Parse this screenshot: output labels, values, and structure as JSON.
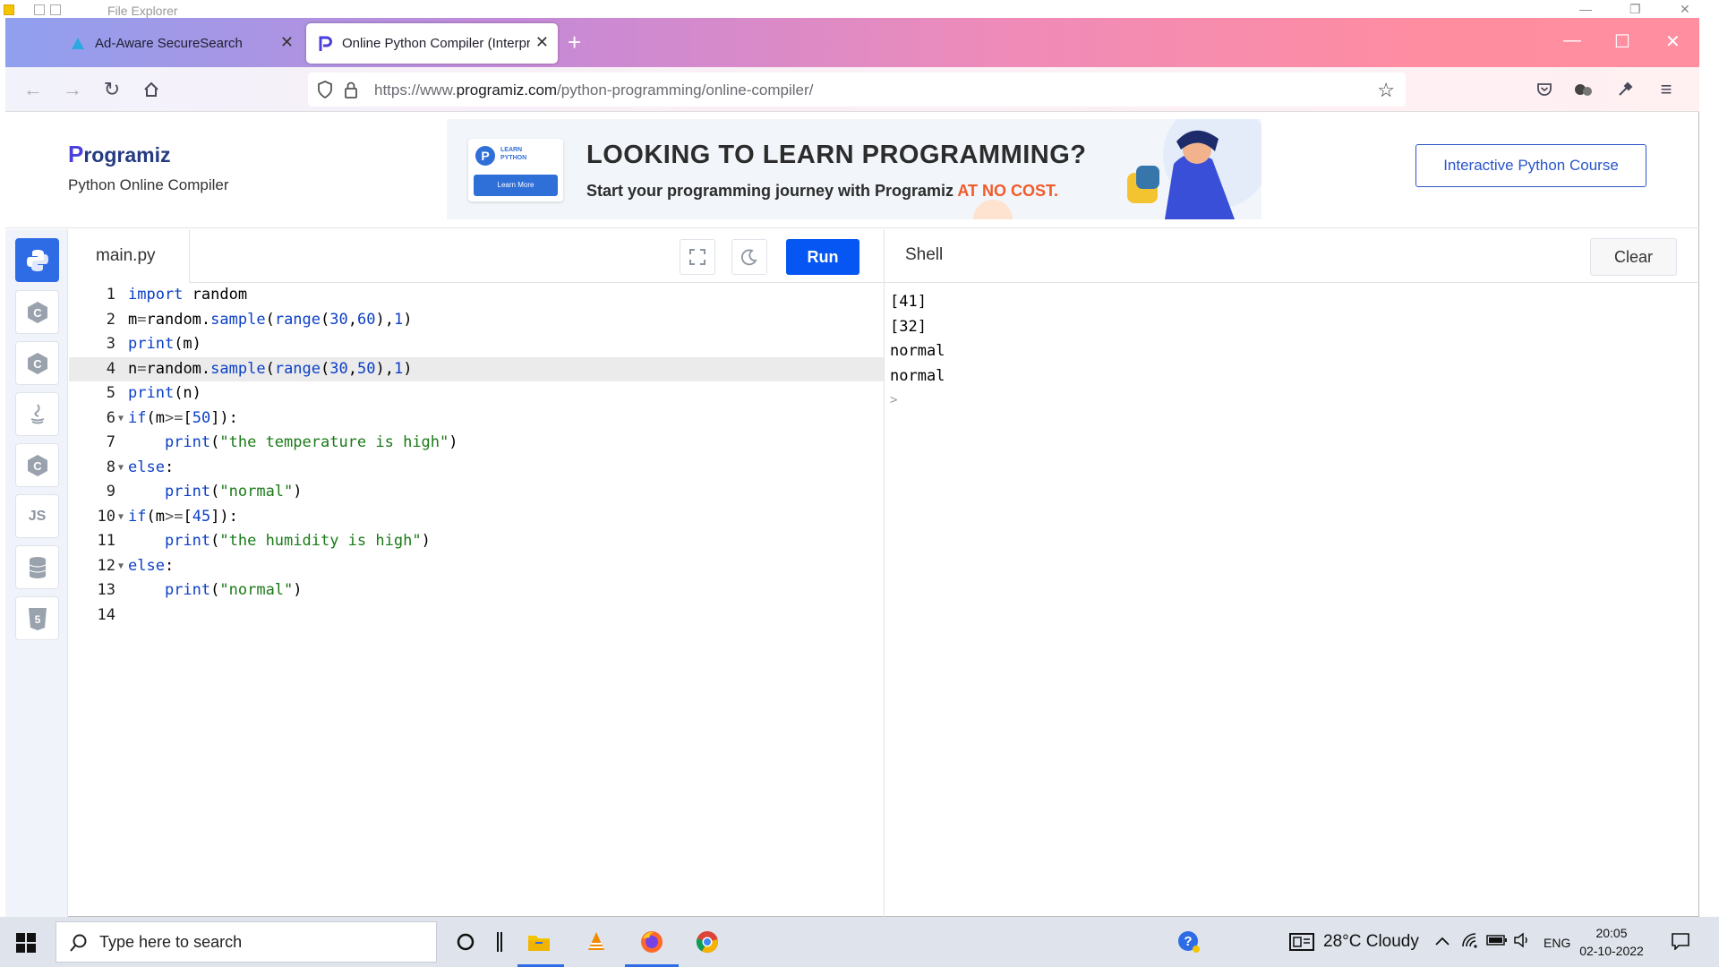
{
  "explorer": {
    "title": "File Explorer"
  },
  "browser": {
    "tabs": [
      {
        "label": "Ad-Aware SecureSearch",
        "active": false
      },
      {
        "label": "Online Python Compiler (Interpreter)",
        "active": true
      }
    ],
    "url_prefix": "https://www.",
    "url_domain": "programiz.com",
    "url_path": "/python-programming/online-compiler/"
  },
  "header": {
    "logo": "rogramiz",
    "logo_p": "P",
    "subtitle": "Python Online Compiler",
    "banner_title": "LOOKING TO LEARN PROGRAMMING?",
    "banner_sub": "Start your programming journey with Programiz ",
    "banner_highlight": "AT NO COST.",
    "banner_card_label": "LEARN PYTHON",
    "banner_card_btn": "Learn More",
    "course_button": "Interactive Python Course"
  },
  "sidebar": {
    "js_label": "JS"
  },
  "editor": {
    "filename": "main.py",
    "run_label": "Run",
    "current_line": 4,
    "lines": [
      {
        "n": "1",
        "fold": false,
        "html": "<span class=\"kw\">import</span> random"
      },
      {
        "n": "2",
        "fold": false,
        "html": "m<span class=\"op\">=</span>random.<span class=\"fn\">sample</span>(<span class=\"fn\">range</span>(<span class=\"nm\">30</span>,<span class=\"nm\">60</span>),<span class=\"nm\">1</span>)"
      },
      {
        "n": "3",
        "fold": false,
        "html": "<span class=\"fn\">print</span>(m)"
      },
      {
        "n": "4",
        "fold": false,
        "html": "n<span class=\"op\">=</span>random.<span class=\"fn\">sample</span>(<span class=\"fn\">range</span>(<span class=\"nm\">30</span>,<span class=\"nm\">50</span>),<span class=\"nm\">1</span>)"
      },
      {
        "n": "5",
        "fold": false,
        "html": "<span class=\"fn\">print</span>(n)"
      },
      {
        "n": "6",
        "fold": true,
        "html": "<span class=\"kw\">if</span>(m<span class=\"op\">&gt;=</span>[<span class=\"nm\">50</span>]):"
      },
      {
        "n": "7",
        "fold": false,
        "html": "    <span class=\"fn\">print</span>(<span class=\"st\">\"the temperature is high\"</span>)"
      },
      {
        "n": "8",
        "fold": true,
        "html": "<span class=\"kw\">else</span>:"
      },
      {
        "n": "9",
        "fold": false,
        "html": "    <span class=\"fn\">print</span>(<span class=\"st\">\"normal\"</span>)"
      },
      {
        "n": "10",
        "fold": true,
        "html": "<span class=\"kw\">if</span>(m<span class=\"op\">&gt;=</span>[<span class=\"nm\">45</span>]):"
      },
      {
        "n": "11",
        "fold": false,
        "html": "    <span class=\"fn\">print</span>(<span class=\"st\">\"the humidity is high\"</span>)"
      },
      {
        "n": "12",
        "fold": true,
        "html": "<span class=\"kw\">else</span>:"
      },
      {
        "n": "13",
        "fold": false,
        "html": "    <span class=\"fn\">print</span>(<span class=\"st\">\"normal\"</span>)"
      },
      {
        "n": "14",
        "fold": false,
        "html": ""
      }
    ]
  },
  "shell": {
    "title": "Shell",
    "clear_label": "Clear",
    "output": [
      "[41]",
      "[32]",
      "normal",
      "normal"
    ],
    "prompt": ">"
  },
  "taskbar": {
    "search_placeholder": "Type here to search",
    "weather": "28°C  Cloudy",
    "lang": "ENG",
    "time": "20:05",
    "date": "02-10-2022"
  },
  "colors": {
    "accent": "#0556f3",
    "brand": "#253b80"
  }
}
